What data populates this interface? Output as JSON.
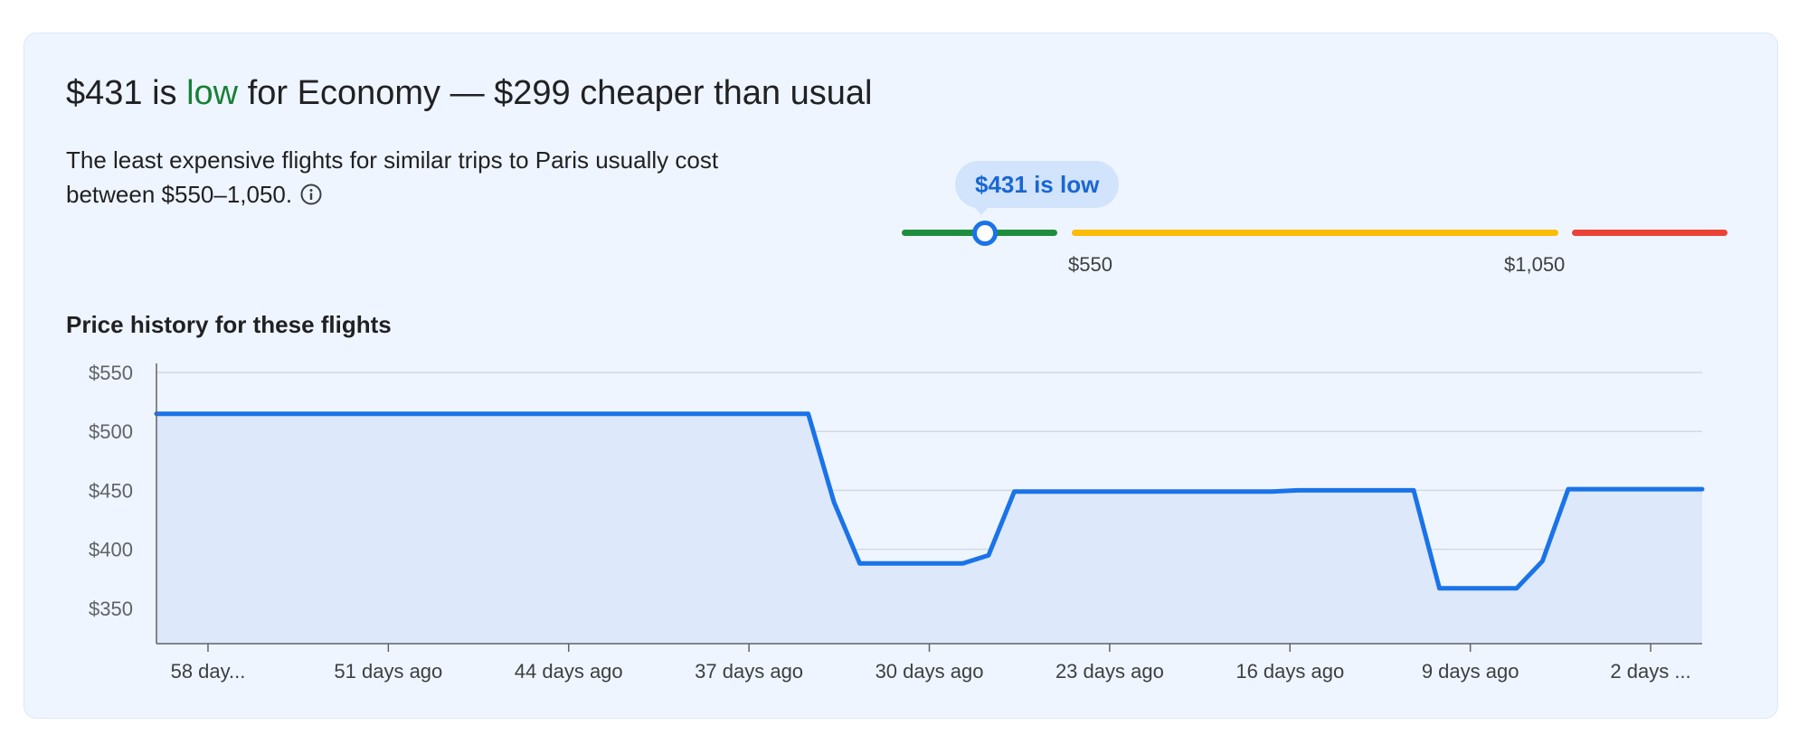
{
  "summary": {
    "headline_price": "$431 is",
    "headline_status": "low",
    "headline_rest": "for Economy — $299 cheaper than usual",
    "description": "The least expensive flights for similar trips to Paris usually cost between $550–1,050.",
    "info_icon": "info-icon"
  },
  "price_range": {
    "bubble_label": "$431 is low",
    "low_label": "$550",
    "high_label": "$1,050",
    "current_price": 431,
    "low_threshold": 550,
    "high_threshold": 1050,
    "colors": {
      "low": "#1e8e3e",
      "typical": "#fbbc04",
      "high": "#ea4335",
      "marker": "#1a73e8"
    }
  },
  "chart_data": {
    "type": "area",
    "title": "Price history for these flights",
    "xlabel": "",
    "ylabel": "",
    "days_ago": [
      60,
      34.7,
      33.7,
      32.7,
      28.7,
      27.7,
      26.7,
      16.7,
      15.7,
      11.2,
      10.2,
      7.2,
      6.2,
      5.2,
      0
    ],
    "prices": [
      515,
      515,
      440,
      388,
      388,
      395,
      449,
      449,
      450,
      450,
      367,
      367,
      390,
      451,
      451
    ],
    "x_ticks": [
      "58 day...",
      "51 days ago",
      "44 days ago",
      "37 days ago",
      "30 days ago",
      "23 days ago",
      "16 days ago",
      "9 days ago",
      "2 days ..."
    ],
    "x_tick_days": [
      58,
      51,
      44,
      37,
      30,
      23,
      16,
      9,
      2
    ],
    "y_ticks": [
      "$550",
      "$500",
      "$450",
      "$400",
      "$350"
    ],
    "y_tick_values": [
      550,
      500,
      450,
      400,
      350
    ],
    "ylim": [
      320,
      550
    ],
    "xlim": [
      60,
      0
    ],
    "grid": true,
    "colors": {
      "line": "#1a73e8",
      "fill": "#dde8fa",
      "grid": "#d3d9e3",
      "axis": "#5f6368"
    }
  }
}
